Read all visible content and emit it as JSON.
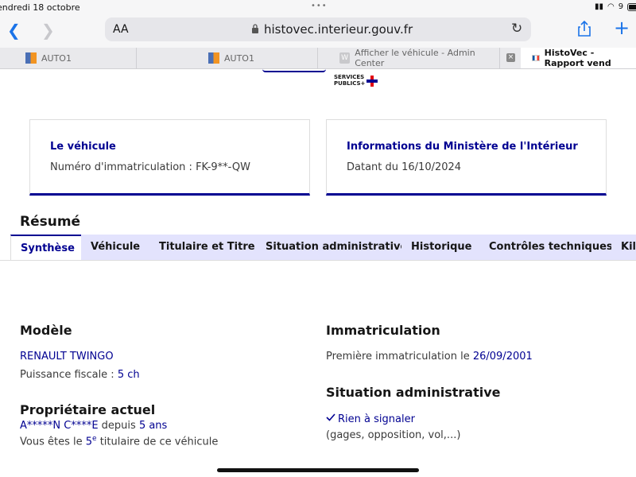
{
  "status_bar": {
    "time": "endredi 18 octobre",
    "battery_pct": "9"
  },
  "browser": {
    "text_size_button": "AA",
    "url": "histovec.interieur.gouv.fr",
    "tabs": [
      {
        "label": "AUTO1",
        "icon": "auto1-favicon"
      },
      {
        "label": "AUTO1",
        "icon": "auto1-favicon"
      },
      {
        "label": "Afficher le véhicule - Admin Center",
        "icon": "admin-favicon"
      },
      {
        "label": "HistoVec - Rapport vend",
        "icon": "french-flag-icon"
      }
    ],
    "admin_fav_letter": "W",
    "close_glyph": "×"
  },
  "header": {
    "logo_line1": "SERVICES",
    "logo_line2": "PUBLICS+"
  },
  "cards": {
    "vehicle": {
      "title": "Le véhicule",
      "text": "Numéro d'immatriculation : FK-9**-QW"
    },
    "ministry": {
      "title": "Informations du Ministère de l'Intérieur",
      "text": "Datant du 16/10/2024"
    }
  },
  "tabs": [
    "Synthèse",
    "Véhicule",
    "Titulaire et Titre",
    "Situation administrative",
    "Historique",
    "Contrôles techniques",
    "Kilo"
  ],
  "summary": {
    "title": "Résumé",
    "model": {
      "heading": "Modèle",
      "name": "RENAULT TWINGO",
      "power_label": "Puissance fiscale : ",
      "power_value": "5 ch"
    },
    "registration": {
      "heading": "Immatriculation",
      "first_label": "Première immatriculation le ",
      "first_date": "26/09/2001"
    },
    "owner": {
      "heading": "Propriétaire actuel",
      "name": "A*****N C****E",
      "since_label": " depuis ",
      "since_value": "5 ans",
      "rank_pre": "Vous êtes le ",
      "rank_num": "5",
      "rank_sup": "e",
      "rank_post": " titulaire de ce véhicule"
    },
    "admin": {
      "heading": "Situation administrative",
      "status": "Rien à signaler",
      "details": "(gages, opposition, vol,...)"
    }
  },
  "colors": {
    "accent": "#000091",
    "tab_bg": "#e3e3fd",
    "ios_blue": "#1a73e8"
  }
}
